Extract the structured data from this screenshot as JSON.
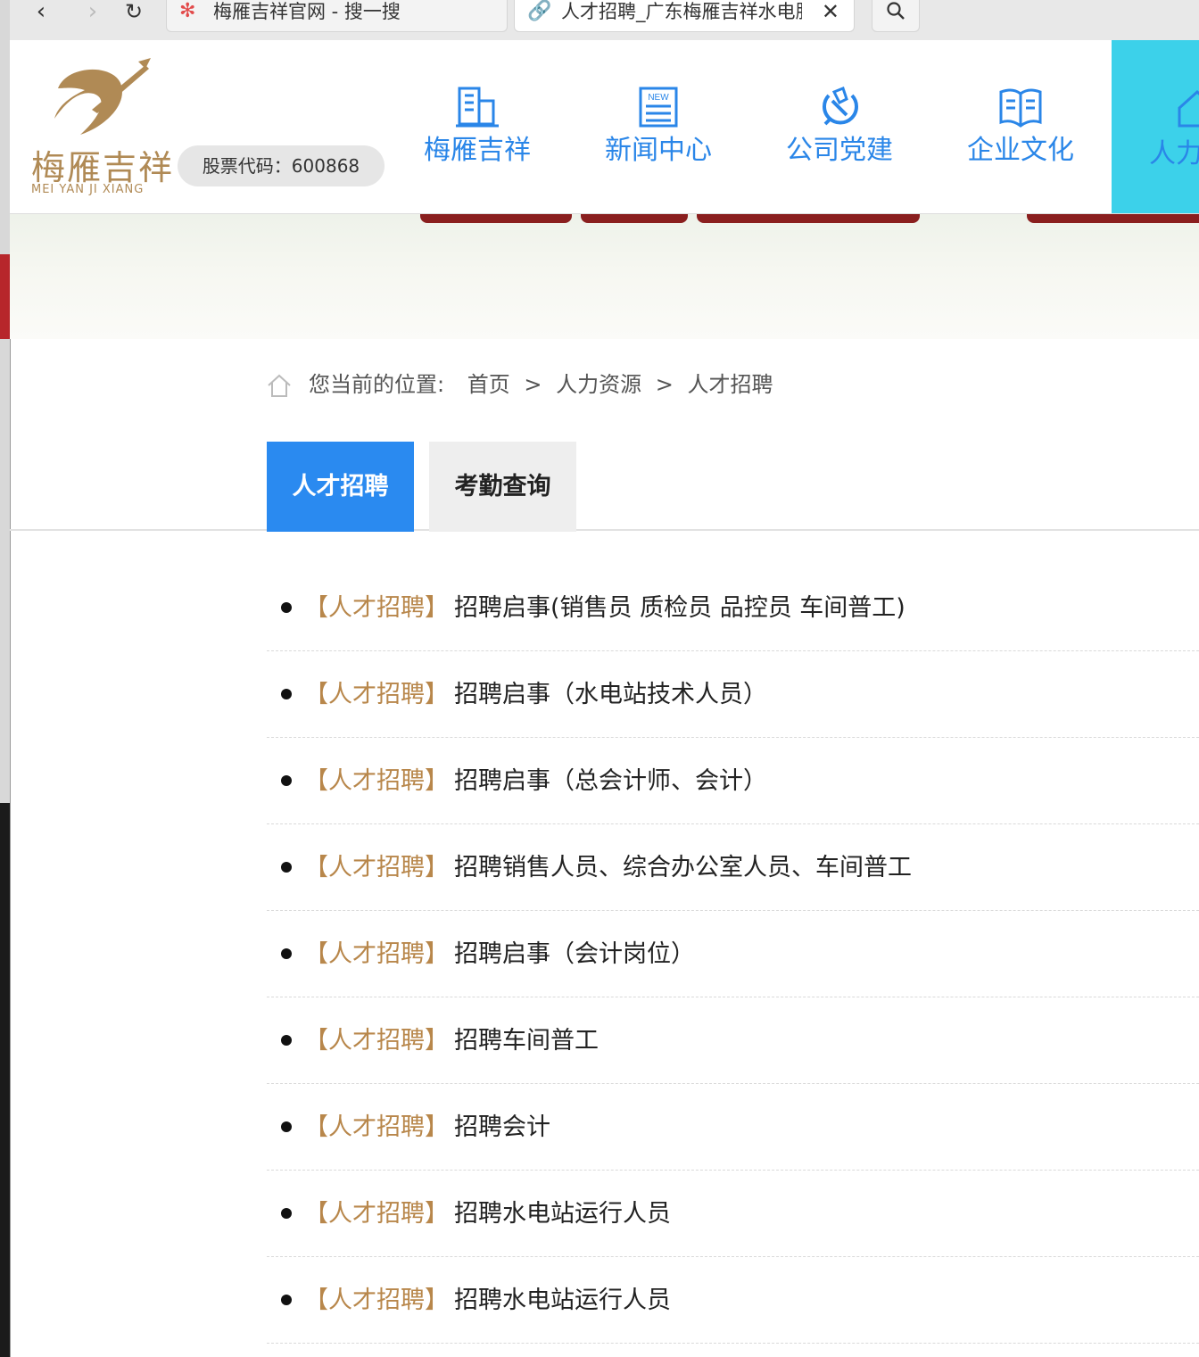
{
  "browser": {
    "tabs": [
      {
        "label": "梅雁吉祥官网 - 搜一搜",
        "icon": "sogou-flower-icon",
        "active": false
      },
      {
        "label": "人才招聘_广东梅雁吉祥水电股",
        "icon": "link-icon",
        "active": true
      }
    ]
  },
  "header": {
    "logo_cn": "梅雁吉祥",
    "logo_en": "MEI YAN JI XIANG",
    "stock_code": "股票代码：600868",
    "nav": [
      {
        "label": "梅雁吉祥",
        "icon": "building-icon"
      },
      {
        "label": "新闻中心",
        "icon": "news-icon"
      },
      {
        "label": "公司党建",
        "icon": "party-emblem-icon"
      },
      {
        "label": "企业文化",
        "icon": "book-icon"
      },
      {
        "label": "人力",
        "icon": "house-icon",
        "active": true
      }
    ]
  },
  "breadcrumb": {
    "prefix": "您当前的位置:",
    "items": [
      "首页",
      "人力资源",
      "人才招聘"
    ],
    "separator": ">"
  },
  "subtabs": [
    {
      "label": "人才招聘",
      "active": true
    },
    {
      "label": "考勤查询",
      "active": false
    }
  ],
  "list": [
    {
      "tag": "【人才招聘】",
      "title": "招聘启事(销售员 质检员 品控员 车间普工)"
    },
    {
      "tag": "【人才招聘】",
      "title": "招聘启事（水电站技术人员）"
    },
    {
      "tag": "【人才招聘】",
      "title": "招聘启事（总会计师、会计）"
    },
    {
      "tag": "【人才招聘】",
      "title": "招聘销售人员、综合办公室人员、车间普工"
    },
    {
      "tag": "【人才招聘】",
      "title": "招聘启事（会计岗位）"
    },
    {
      "tag": "【人才招聘】",
      "title": "招聘车间普工"
    },
    {
      "tag": "【人才招聘】",
      "title": "招聘会计"
    },
    {
      "tag": "【人才招聘】",
      "title": "招聘水电站运行人员"
    },
    {
      "tag": "【人才招聘】",
      "title": "招聘水电站运行人员"
    }
  ],
  "colors": {
    "nav_blue": "#2a86e8",
    "nav_active_bg": "#3cd1ea",
    "tab_active_bg": "#2a8af0",
    "tag_gold": "#b8874b",
    "logo_gold": "#b08a55"
  }
}
